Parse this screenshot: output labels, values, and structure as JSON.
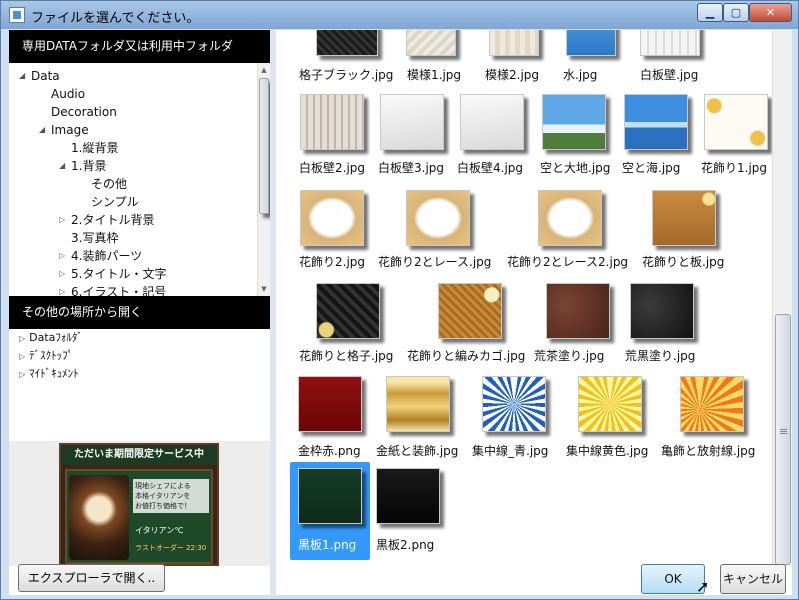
{
  "window": {
    "title": "ファイルを選んでください。",
    "controls": {
      "minimize": "▁",
      "maximize": "▢",
      "close": "✕"
    }
  },
  "left": {
    "section1_title": "専用DATAフォルダ又は利用中フォルダ",
    "tree": [
      {
        "label": "Data",
        "arrow": "◢"
      },
      {
        "label": "Audio",
        "arrow": ""
      },
      {
        "label": "Decoration",
        "arrow": ""
      },
      {
        "label": "Image",
        "arrow": "◢"
      },
      {
        "label": "1.縦背景",
        "arrow": ""
      },
      {
        "label": "1.背景",
        "arrow": "◢"
      },
      {
        "label": "その他",
        "arrow": ""
      },
      {
        "label": "シンプル",
        "arrow": ""
      },
      {
        "label": "2.タイトル背景",
        "arrow": "▷"
      },
      {
        "label": "3.写真枠",
        "arrow": ""
      },
      {
        "label": "4.装飾パーツ",
        "arrow": "▷"
      },
      {
        "label": "5.タイトル・文字",
        "arrow": "▷"
      },
      {
        "label": "6.イラスト・記号",
        "arrow": "▷"
      }
    ],
    "section2_title": "その他の場所から開く",
    "places": [
      {
        "label": "Dataﾌｫﾙﾀﾞ",
        "arrow": "▷"
      },
      {
        "label": "ﾃﾞｽｸﾄｯﾌﾟ",
        "arrow": "▷"
      },
      {
        "label": "ﾏｲﾄﾞｷｭﾒﾝﾄ",
        "arrow": "▷"
      }
    ],
    "promo": {
      "headline": "ただいま期間限定サービス中",
      "body": "現地シェフによる\n本格イタリアンを\nお値打ち価格で！",
      "sign": "イタリアン℃",
      "time": "ラストオーダー 22:30"
    },
    "explorer_button": "エクスプローラで開く.."
  },
  "files": [
    {
      "name": "格子ブラック.jpg",
      "thumb": "dark-lattice"
    },
    {
      "name": "模様1.jpg",
      "thumb": "pattern"
    },
    {
      "name": "模様2.jpg",
      "thumb": "pattern2"
    },
    {
      "name": "水.jpg",
      "thumb": "water"
    },
    {
      "name": "白板壁.jpg",
      "thumb": "wall"
    },
    {
      "name": "白板壁2.jpg",
      "thumb": "wood-stripes"
    },
    {
      "name": "白板壁3.jpg",
      "thumb": "white-wall"
    },
    {
      "name": "白板壁4.jpg",
      "thumb": "white-wall"
    },
    {
      "name": "空と大地.jpg",
      "thumb": "sky-land"
    },
    {
      "name": "空と海.jpg",
      "thumb": "sky-sea"
    },
    {
      "name": "花飾り1.jpg",
      "thumb": "flower-white"
    },
    {
      "name": "花飾り2.jpg",
      "thumb": "flower-frame"
    },
    {
      "name": "花飾り2とレース.jpg",
      "thumb": "flower-frame"
    },
    {
      "name": "花飾り2とレース2.jpg",
      "thumb": "flower-frame"
    },
    {
      "name": "花飾りと板.jpg",
      "thumb": "flower-board"
    },
    {
      "name": "花飾りと格子.jpg",
      "thumb": "flower-dark"
    },
    {
      "name": "花飾りと編みカゴ.jpg",
      "thumb": "flower-basket"
    },
    {
      "name": "荒茶塗り.jpg",
      "thumb": "rough-brown"
    },
    {
      "name": "荒黒塗り.jpg",
      "thumb": "rough-black"
    },
    {
      "name": "金枠赤.png",
      "thumb": "gold-red"
    },
    {
      "name": "金紙と装飾.jpg",
      "thumb": "gold-paper"
    },
    {
      "name": "集中線_青.jpg",
      "thumb": "burst-blue"
    },
    {
      "name": "集中線黄色.jpg",
      "thumb": "burst-yellow"
    },
    {
      "name": "亀飾と放射線.jpg",
      "thumb": "burst-orange"
    },
    {
      "name": "黒板1.png",
      "thumb": "blackboard-green",
      "selected": true
    },
    {
      "name": "黒板2.png",
      "thumb": "blackboard-black"
    }
  ],
  "buttons": {
    "ok": "OK",
    "cancel": "キャンセル"
  }
}
